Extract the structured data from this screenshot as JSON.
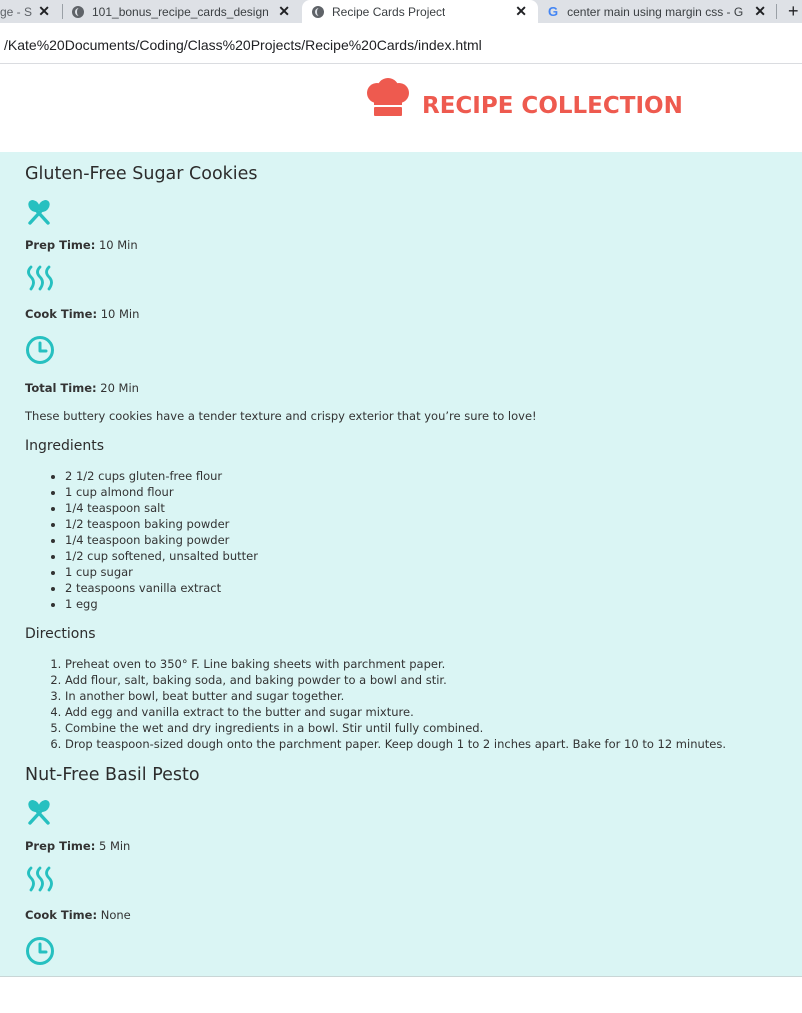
{
  "browser": {
    "tabs": [
      {
        "title": "ge - S",
        "active": false
      },
      {
        "title": "101_bonus_recipe_cards_design_",
        "active": false
      },
      {
        "title": "Recipe Cards Project",
        "active": true
      },
      {
        "title": "center main using margin css - G",
        "active": false
      }
    ],
    "close_glyph": "✕",
    "new_tab_glyph": "+",
    "url": "/Kate%20Documents/Coding/Class%20Projects/Recipe%20Cards/index.html"
  },
  "header": {
    "title": "RECIPE COLLECTION",
    "icon": "chef-hat-icon",
    "brand_color": "#ee5a4f"
  },
  "theme": {
    "main_bg": "#daf5f4",
    "icon_color": "#26c0c0"
  },
  "recipes": [
    {
      "title": "Gluten-Free Sugar Cookies",
      "prep_label": "Prep Time:",
      "prep_value": "10 Min",
      "cook_label": "Cook Time:",
      "cook_value": "10 Min",
      "total_label": "Total Time:",
      "total_value": "20 Min",
      "description": "These buttery cookies have a tender texture and crispy exterior that you’re sure to love!",
      "ingredients_heading": "Ingredients",
      "ingredients": [
        "2 1/2 cups gluten-free flour",
        "1 cup almond flour",
        "1/4 teaspoon salt",
        "1/2 teaspoon baking powder",
        "1/4 teaspoon baking powder",
        "1/2 cup softened, unsalted butter",
        "1 cup sugar",
        "2 teaspoons vanilla extract",
        "1 egg"
      ],
      "directions_heading": "Directions",
      "directions": [
        "Preheat oven to 350° F. Line baking sheets with parchment paper.",
        "Add flour, salt, baking soda, and baking powder to a bowl and stir.",
        "In another bowl, beat butter and sugar together.",
        "Add egg and vanilla extract to the butter and sugar mixture.",
        "Combine the wet and dry ingredients in a bowl. Stir until fully combined.",
        "Drop teaspoon-sized dough onto the parchment paper. Keep dough 1 to 2 inches apart. Bake for 10 to 12 minutes."
      ]
    },
    {
      "title": "Nut-Free Basil Pesto",
      "prep_label": "Prep Time:",
      "prep_value": "5 Min",
      "cook_label": "Cook Time:",
      "cook_value": "None"
    }
  ]
}
